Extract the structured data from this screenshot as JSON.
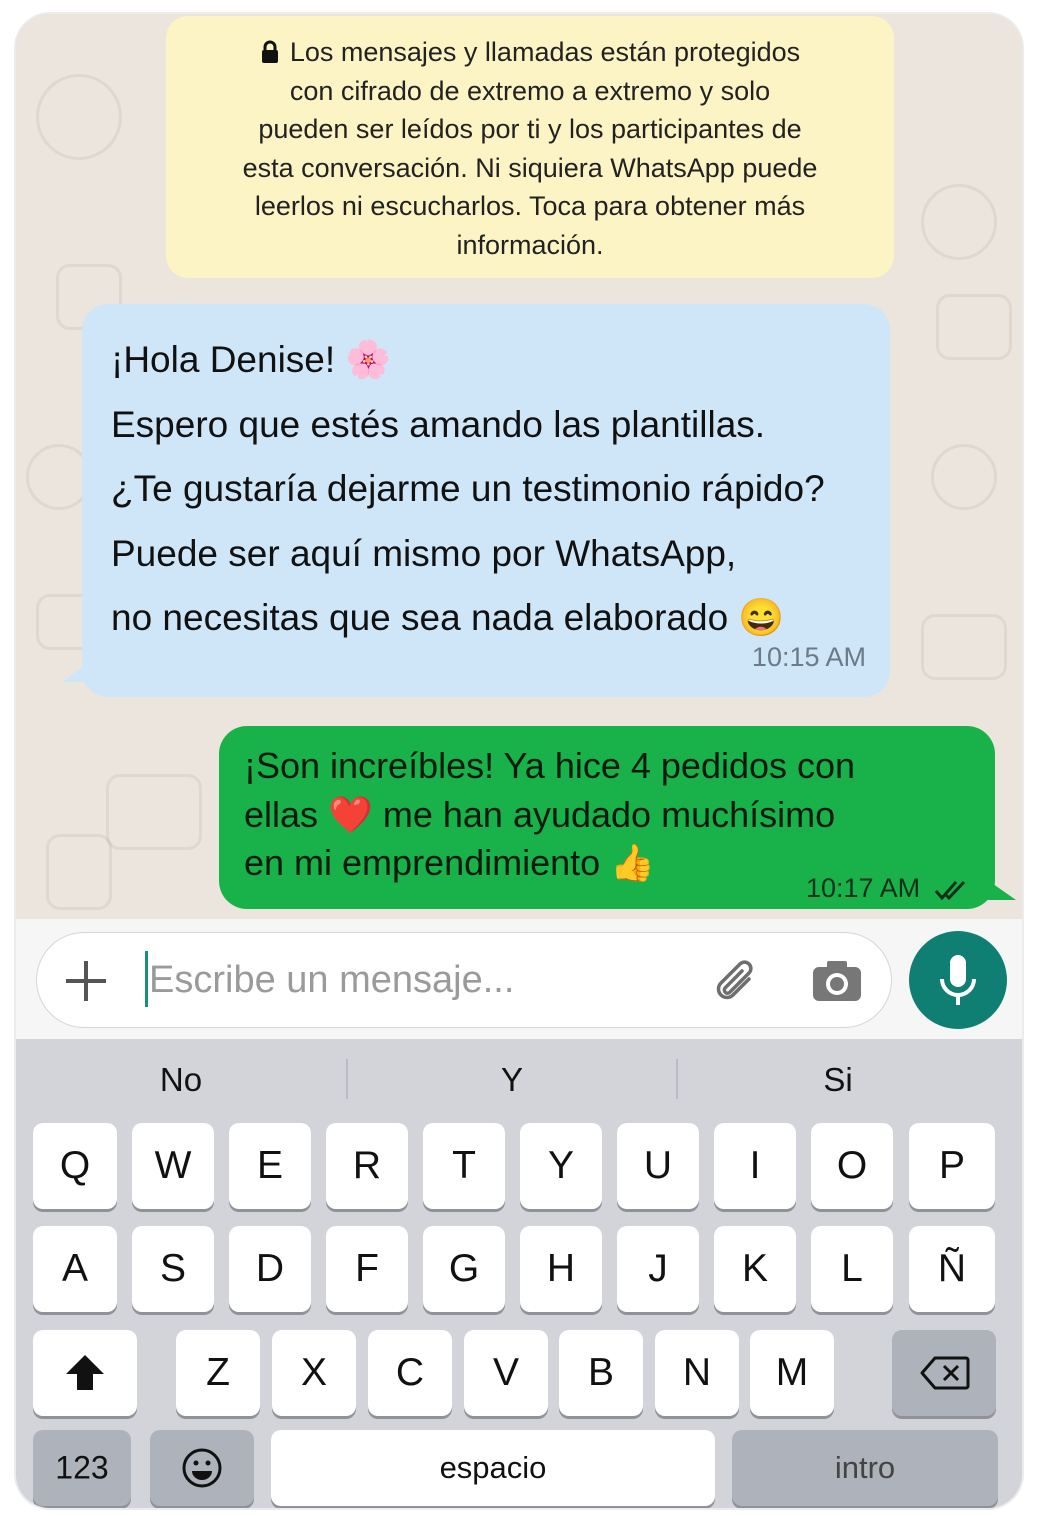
{
  "encryption_notice": {
    "lines": [
      "Los mensajes y llamadas están protegidos",
      "con cifrado de extremo a extremo y solo",
      "pueden ser leídos por ti y los participantes de",
      "esta conversación. Ni siquiera WhatsApp puede",
      "leerlos ni escucharlos. Toca para obtener más",
      "información."
    ],
    "icon": "lock-icon"
  },
  "messages": {
    "incoming": {
      "lines": [
        "¡Hola Denise! 🌸",
        "Espero que estés amando las plantillas.",
        "¿Te gustaría dejarme un testimonio rápido?",
        "Puede ser aquí mismo por WhatsApp,",
        "no necesitas que sea nada elaborado 😄"
      ],
      "time": "10:15 AM"
    },
    "outgoing": {
      "lines": [
        "¡Son increíbles! Ya hice 4 pedidos con",
        "ellas ❤️ me han ayudado muchísimo",
        "en mi emprendimiento 👍"
      ],
      "time": "10:17 AM",
      "status_icon": "double-check-icon"
    }
  },
  "input": {
    "placeholder": "Escribe un mensaje...",
    "icons": [
      "plus-icon",
      "paperclip-icon",
      "camera-icon",
      "microphone-icon"
    ]
  },
  "keyboard": {
    "suggestions": [
      "No",
      "Y",
      "Si"
    ],
    "row1": [
      "Q",
      "W",
      "E",
      "R",
      "T",
      "Y",
      "U",
      "I",
      "O",
      "P"
    ],
    "row2": [
      "A",
      "S",
      "D",
      "F",
      "G",
      "H",
      "J",
      "K",
      "L",
      "Ñ"
    ],
    "row3": [
      "Z",
      "X",
      "C",
      "V",
      "B",
      "N",
      "M"
    ],
    "numbers_label": "123",
    "space_label": "espacio",
    "return_label": "intro",
    "icons": [
      "shift-icon",
      "backspace-icon",
      "emoji-icon"
    ]
  },
  "colors": {
    "chat_background": "#ece5dd",
    "notice_background": "#fdf4c5",
    "incoming_bubble": "#cfe6f8",
    "outgoing_bubble": "#19b24a",
    "mic_button": "#0e7f72",
    "keyboard_background": "#d2d4d9"
  }
}
